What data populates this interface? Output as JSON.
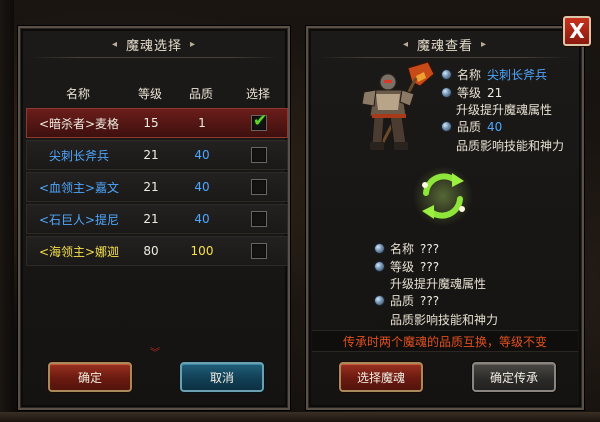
{
  "close_button": {
    "label": "X"
  },
  "left_panel": {
    "title": "魔魂选择",
    "columns": [
      "名称",
      "等级",
      "品质",
      "选择"
    ],
    "rows": [
      {
        "name": "<暗杀者>麦格",
        "level": "15",
        "quality": "1",
        "checked": true,
        "name_color": "white",
        "quality_color": "white"
      },
      {
        "name": "尖刺长斧兵",
        "level": "21",
        "quality": "40",
        "checked": false,
        "name_color": "blue",
        "quality_color": "blue"
      },
      {
        "name": "<血领主>嘉文",
        "level": "21",
        "quality": "40",
        "checked": false,
        "name_color": "blue",
        "quality_color": "blue"
      },
      {
        "name": "<石巨人>提尼",
        "level": "21",
        "quality": "40",
        "checked": false,
        "name_color": "blue",
        "quality_color": "blue"
      },
      {
        "name": "<海领主>娜迦",
        "level": "80",
        "quality": "100",
        "checked": false,
        "name_color": "yellow",
        "quality_color": "yellow"
      }
    ],
    "confirm_label": "确定",
    "cancel_label": "取消"
  },
  "right_panel": {
    "title": "魔魂查看",
    "top": {
      "name_label": "名称",
      "name_value": "尖刺长斧兵",
      "level_label": "等级",
      "level_value": "21",
      "level_note": "升级提升魔魂属性",
      "quality_label": "品质",
      "quality_value": "40",
      "quality_note": "品质影响技能和神力"
    },
    "bottom": {
      "name_label": "名称",
      "name_value": "???",
      "level_label": "等级",
      "level_value": "???",
      "level_note": "升级提升魔魂属性",
      "quality_label": "品质",
      "quality_value": "???",
      "quality_note": "品质影响技能和神力"
    },
    "warning": "传承时两个魔魂的品质互换，等级不变",
    "select_label": "选择魔魂",
    "inherit_label": "确定传承"
  },
  "colors": {
    "blue": "#4ea7ff",
    "yellow": "#f4e04a",
    "warning": "#e0501e",
    "check": "#5fd62a",
    "selected_row": "#6b1d1a"
  },
  "icons": [
    "close-icon",
    "check-icon",
    "chevron-down-icon",
    "swap-arrows-icon",
    "orb-icon"
  ]
}
